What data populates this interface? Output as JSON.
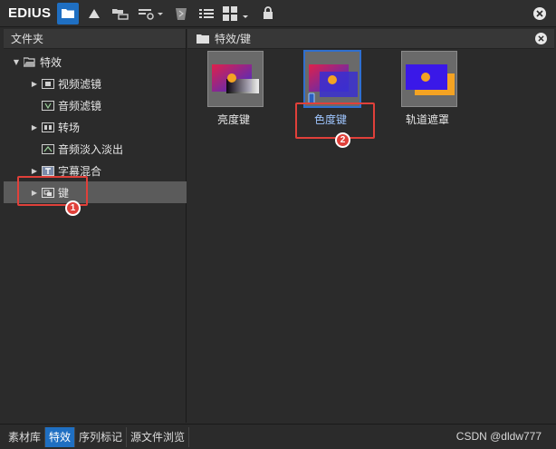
{
  "app": {
    "logo": "EDIUS"
  },
  "toolbar": {
    "buttons": [
      "folder-icon",
      "triangle-icon",
      "folder-link-icon",
      "add-effect-icon",
      "trash-icon",
      "list-view-icon",
      "grid-view-icon",
      "lock-icon"
    ]
  },
  "folder_panel": {
    "header": "文件夹",
    "tree": [
      {
        "label": "特效",
        "level": 0,
        "expanded": true
      },
      {
        "label": "视频滤镜",
        "level": 1,
        "has_children": true
      },
      {
        "label": "音频滤镜",
        "level": 1,
        "has_children": false
      },
      {
        "label": "转场",
        "level": 1,
        "has_children": true
      },
      {
        "label": "音频淡入淡出",
        "level": 1,
        "has_children": false
      },
      {
        "label": "字幕混合",
        "level": 1,
        "has_children": true
      },
      {
        "label": "键",
        "level": 1,
        "has_children": true,
        "selected": true
      }
    ]
  },
  "content_panel": {
    "breadcrumb": "特效/键",
    "items": [
      {
        "label": "亮度键",
        "selected": false
      },
      {
        "label": "色度键",
        "selected": true
      },
      {
        "label": "轨道遮罩",
        "selected": false
      }
    ]
  },
  "bottom_tabs": {
    "tabs": [
      "素材库",
      "特效",
      "序列标记",
      "源文件浏览"
    ],
    "active": "特效"
  },
  "watermark": "CSDN @dldw777",
  "annotations": {
    "badge1": "1",
    "badge2": "2"
  },
  "colors": {
    "accent": "#1f6fc2",
    "annotation": "#e0403a"
  }
}
